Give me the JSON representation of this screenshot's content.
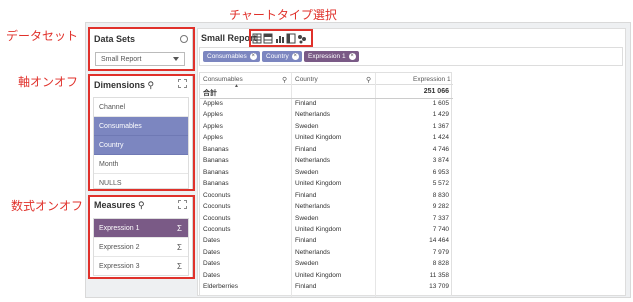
{
  "annotations": {
    "chart_type_select": "チャートタイプ選択",
    "datasets": "データセット",
    "dimensions_toggle": "軸オンオフ",
    "measures_toggle": "数式オンオフ"
  },
  "datasets": {
    "title": "Data Sets",
    "selected": "Small Report"
  },
  "dimensions": {
    "title": "Dimensions",
    "items": [
      {
        "label": "Channel",
        "selected": false
      },
      {
        "label": "Consumables",
        "selected": true
      },
      {
        "label": "Country",
        "selected": true
      },
      {
        "label": "Month",
        "selected": false
      },
      {
        "label": "NULLS",
        "selected": false
      }
    ]
  },
  "measures": {
    "title": "Measures",
    "items": [
      {
        "label": "Expression 1",
        "selected": true
      },
      {
        "label": "Expression 2",
        "selected": false
      },
      {
        "label": "Expression 3",
        "selected": false
      }
    ],
    "sigma": "Σ"
  },
  "report": {
    "title": "Small Report",
    "chips": [
      {
        "label": "Consumables",
        "color": "#7c86c0"
      },
      {
        "label": "Country",
        "color": "#7c86c0"
      },
      {
        "label": "Expression 1",
        "color": "#7a5a86"
      }
    ]
  },
  "table": {
    "headers": {
      "col1": "Consumables",
      "col2": "Country",
      "col3": "Expression 1"
    },
    "total_label": "合計",
    "total_value": "251 066",
    "rows": [
      [
        "Apples",
        "Finland",
        "1 605"
      ],
      [
        "Apples",
        "Netherlands",
        "1 429"
      ],
      [
        "Apples",
        "Sweden",
        "1 367"
      ],
      [
        "Apples",
        "United Kingdom",
        "1 424"
      ],
      [
        "Bananas",
        "Finland",
        "4 746"
      ],
      [
        "Bananas",
        "Netherlands",
        "3 874"
      ],
      [
        "Bananas",
        "Sweden",
        "6 953"
      ],
      [
        "Bananas",
        "United Kingdom",
        "5 572"
      ],
      [
        "Coconuts",
        "Finland",
        "8 830"
      ],
      [
        "Coconuts",
        "Netherlands",
        "9 282"
      ],
      [
        "Coconuts",
        "Sweden",
        "7 337"
      ],
      [
        "Coconuts",
        "United Kingdom",
        "7 740"
      ],
      [
        "Dates",
        "Finland",
        "14 464"
      ],
      [
        "Dates",
        "Netherlands",
        "7 979"
      ],
      [
        "Dates",
        "Sweden",
        "8 828"
      ],
      [
        "Dates",
        "United Kingdom",
        "11 358"
      ],
      [
        "Elderberries",
        "Finland",
        "13 709"
      ]
    ]
  }
}
